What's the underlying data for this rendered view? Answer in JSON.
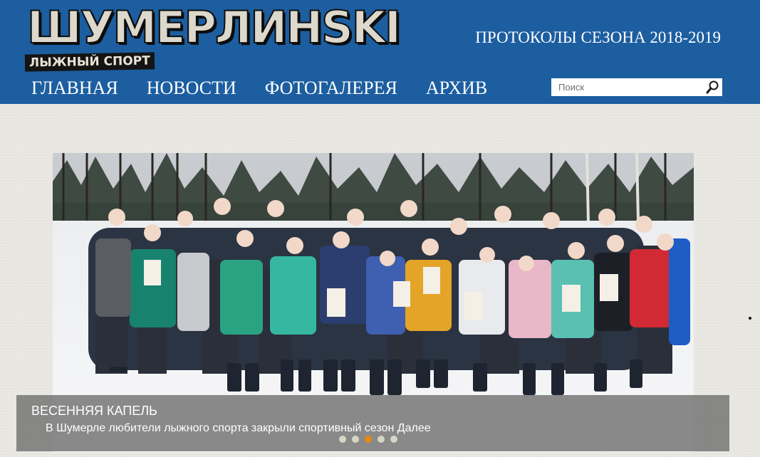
{
  "header": {
    "logo_title": "ШУМЕРЛИНSKI",
    "logo_subtitle": "ЛЫЖНЫЙ СПОРТ",
    "season_link": "ПРОТОКОЛЫ СЕЗОНА 2018-2019"
  },
  "nav": {
    "items": [
      {
        "label": "ГЛАВНАЯ"
      },
      {
        "label": "НОВОСТИ"
      },
      {
        "label": "ФОТОГАЛЕРЕЯ"
      },
      {
        "label": "АРХИВ"
      }
    ]
  },
  "search": {
    "placeholder": "Поиск",
    "value": "",
    "icon": "search-icon"
  },
  "slider": {
    "title": "ВЕСЕННЯЯ КАПЕЛЬ",
    "text": "В Шумерле любители лыжного спорта закрыли спортивный сезон",
    "more_label": "Далее",
    "dots_count": 5,
    "active_dot": 3
  },
  "colors": {
    "header_bg": "#1c5ea0",
    "page_bg": "#e9e8e2",
    "dot_inactive": "#d6d6c6",
    "dot_active": "#e7880f",
    "caption_bg": "rgba(118,118,118,0.85)"
  }
}
